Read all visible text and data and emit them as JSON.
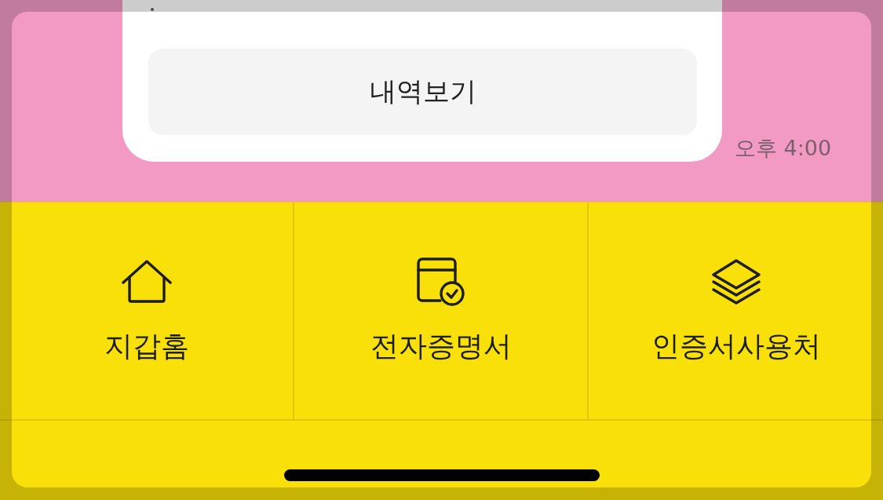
{
  "chat": {
    "message_card": {
      "action_button": "내역보기"
    },
    "time": "오후 4:00"
  },
  "tab_bar": {
    "items": [
      {
        "kind": "home",
        "label": "지갑홈"
      },
      {
        "kind": "certificate",
        "label": "전자증명서"
      },
      {
        "kind": "usage",
        "label": "인증서사용처"
      }
    ]
  }
}
